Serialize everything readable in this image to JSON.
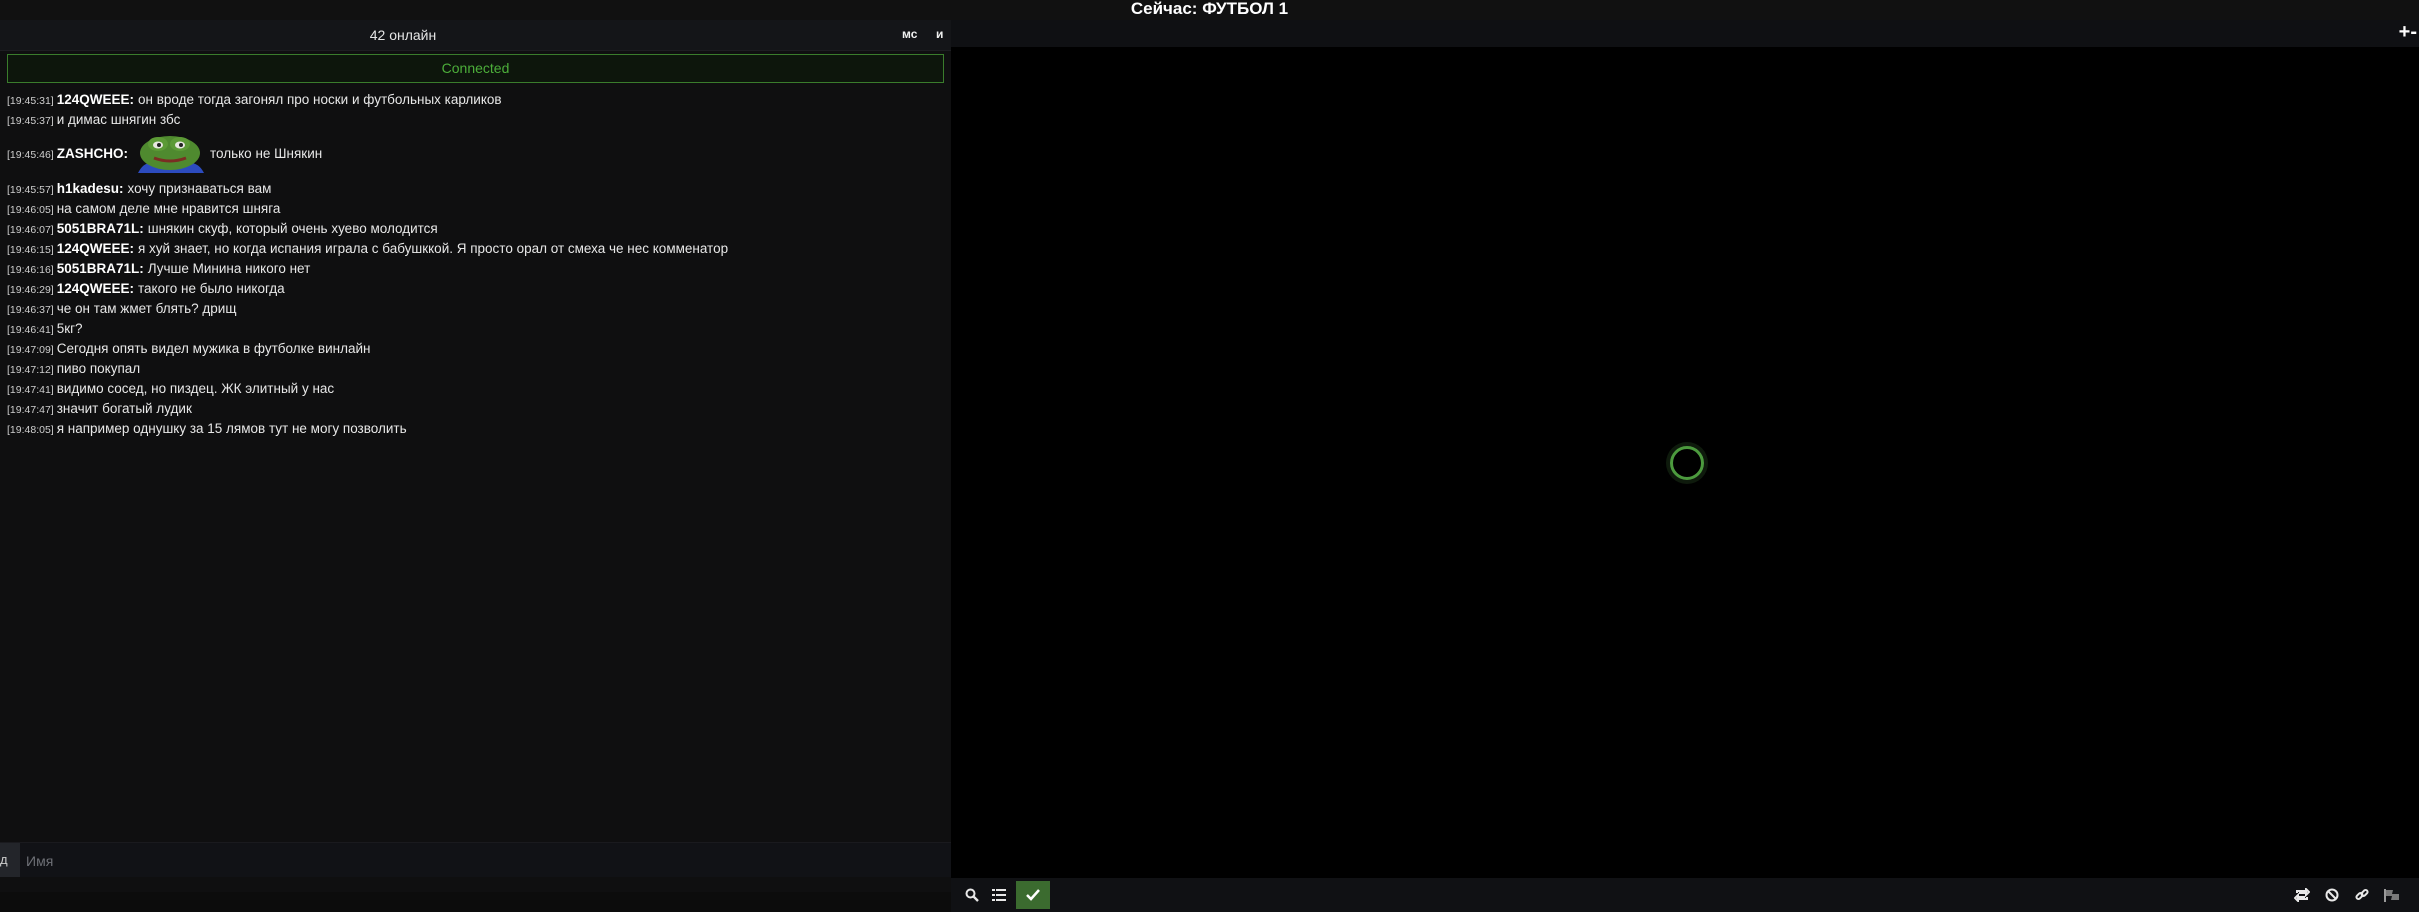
{
  "header": {
    "title": "Сейчас: ФУТБОЛ 1"
  },
  "chat": {
    "online": "42 онлайн",
    "btn_ms": "мс",
    "btn_i": "и",
    "status": "Connected",
    "messages": [
      {
        "time": "[19:45:31]",
        "user": "124QWEEE:",
        "text": "он вроде тогда загонял про носки и футбольных карликов"
      },
      {
        "time": "[19:45:37]",
        "user": "",
        "text": "и димас шнягин збс"
      },
      {
        "time": "[19:45:46]",
        "user": "ZASHCHO:",
        "text": "только не Шнякин",
        "emote": "pepe-emote"
      },
      {
        "time": "[19:45:57]",
        "user": "h1kadesu:",
        "text": "хочу признаваться вам"
      },
      {
        "time": "[19:46:05]",
        "user": "",
        "text": "на самом деле мне нравится шняга"
      },
      {
        "time": "[19:46:07]",
        "user": "5051BRA71L:",
        "text": "шнякин скуф, который очень хуево молодится"
      },
      {
        "time": "[19:46:15]",
        "user": "124QWEEE:",
        "text": "я хуй знает, но когда испания играла с бабушккой. Я просто орал от смеха че нес комменатор"
      },
      {
        "time": "[19:46:16]",
        "user": "5051BRA71L:",
        "text": "Лучше Минина никого нет"
      },
      {
        "time": "[19:46:29]",
        "user": "124QWEEE:",
        "text": "такого не было никогда"
      },
      {
        "time": "[19:46:37]",
        "user": "",
        "text": "че он там жмет блять? дрищ"
      },
      {
        "time": "[19:46:41]",
        "user": "",
        "text": "5кг?"
      },
      {
        "time": "[19:47:09]",
        "user": "",
        "text": "Сегодня опять видел мужика в футболке винлайн"
      },
      {
        "time": "[19:47:12]",
        "user": "",
        "text": "пиво покупал"
      },
      {
        "time": "[19:47:41]",
        "user": "",
        "text": "видимо сосед, но пиздец. ЖК элитный у нас"
      },
      {
        "time": "[19:47:47]",
        "user": "",
        "text": "значит богатый лудик"
      },
      {
        "time": "[19:48:05]",
        "user": "",
        "text": "я например однушку за 15 лямов тут не могу позволить"
      }
    ],
    "input": {
      "toggle_label": "д",
      "placeholder": "Имя"
    }
  },
  "player": {
    "zoom_icons": "+-",
    "controls_left": [
      "search-icon",
      "list-icon",
      "check-icon"
    ],
    "controls_right": [
      "repeat-icon",
      "block-icon",
      "link-icon",
      "flag-icon"
    ],
    "accent": "#3b6b2f",
    "spinner_color": "#4c9a3e"
  }
}
